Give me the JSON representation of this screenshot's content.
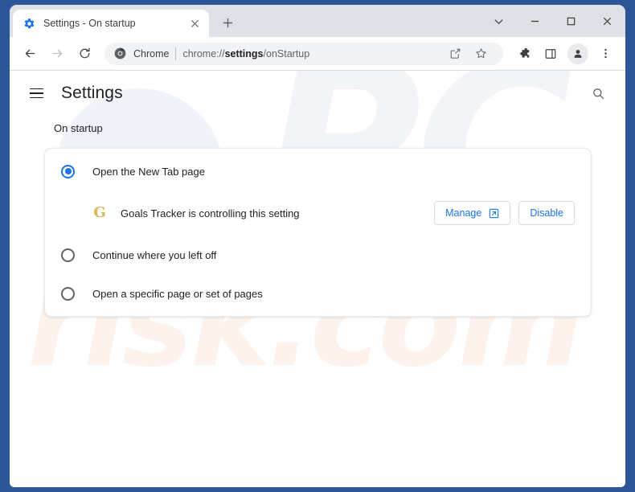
{
  "window": {
    "controls": {
      "tab_search": "tab-search-chevron",
      "minimize": "minimize",
      "maximize": "maximize",
      "close": "close"
    }
  },
  "tabstrip": {
    "tab": {
      "favicon": "settings-gear-icon",
      "title": "Settings - On startup",
      "close_label": "✕"
    },
    "new_tab_label": "+"
  },
  "toolbar": {
    "back_icon": "back-arrow-icon",
    "forward_icon": "forward-arrow-icon",
    "reload_icon": "reload-icon",
    "omnibox": {
      "site_icon": "chrome-logo-icon",
      "scheme_label": "Chrome",
      "url_prefix": "chrome://",
      "url_bold": "settings",
      "url_suffix": "/onStartup"
    },
    "share_icon": "share-icon",
    "bookmark_icon": "bookmark-star-icon",
    "extensions_icon": "extensions-puzzle-icon",
    "side_panel_icon": "side-panel-icon",
    "profile_icon": "profile-avatar-icon",
    "menu_icon": "three-dot-menu-icon"
  },
  "settings": {
    "menu_icon": "hamburger-menu-icon",
    "title": "Settings",
    "search_icon": "search-icon",
    "section_label": "On startup",
    "options": [
      {
        "label": "Open the New Tab page",
        "checked": true
      },
      {
        "label": "Continue where you left off",
        "checked": false
      },
      {
        "label": "Open a specific page or set of pages",
        "checked": false
      }
    ],
    "extension_notice": {
      "icon_letter": "G",
      "icon_name": "goals-tracker-extension-icon",
      "text": "Goals Tracker is controlling this setting",
      "manage_label": "Manage",
      "manage_icon": "external-link-icon",
      "disable_label": "Disable"
    }
  },
  "watermark": {
    "top": "PC",
    "bottom": "risk.com"
  },
  "colors": {
    "frame": "#2c5697",
    "accent": "#1a73e8",
    "tabstrip": "#dee1e6",
    "omnibox": "#f1f3f4",
    "ext_icon": "#d9b451"
  }
}
